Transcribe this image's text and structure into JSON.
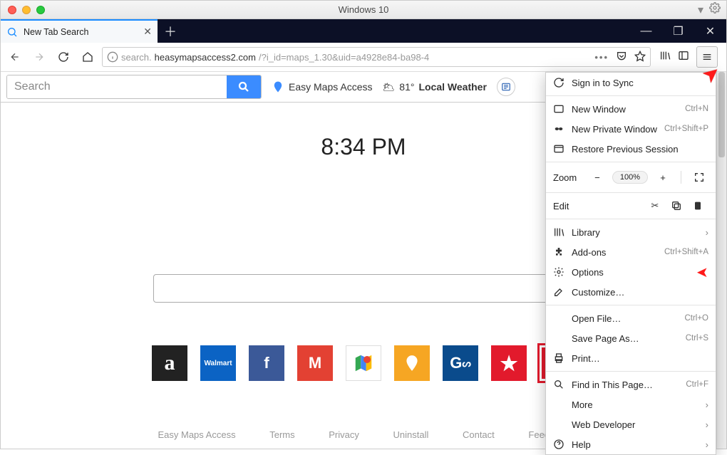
{
  "mac": {
    "title": "Windows 10"
  },
  "tab": {
    "title": "New Tab Search"
  },
  "nav": {
    "url_host": "heasymapsaccess2.com",
    "url_path": "/?i_id=maps_1.30&uid=a4928e84-ba98-4",
    "url_pre": "search."
  },
  "toolbar": {
    "search_placeholder": "Search",
    "ext_name": "Easy Maps Access",
    "weather_temp": "81°",
    "weather_label": "Local Weather"
  },
  "clock": "8:34 PM",
  "tiles": {
    "amazon": "a",
    "walmart": "Walmart",
    "fb": "f",
    "gmail": "M",
    "gmaps": "",
    "ymaps": "",
    "gas": "G",
    "macys": "★",
    "target": ""
  },
  "footer": {
    "a": "Easy Maps Access",
    "b": "Terms",
    "c": "Privacy",
    "d": "Uninstall",
    "e": "Contact",
    "f": "Feedback"
  },
  "menu": {
    "signin": "Sign in to Sync",
    "new_window": "New Window",
    "new_window_kb": "Ctrl+N",
    "priv_window": "New Private Window",
    "priv_window_kb": "Ctrl+Shift+P",
    "restore": "Restore Previous Session",
    "zoom_label": "Zoom",
    "zoom_pct": "100%",
    "edit_label": "Edit",
    "library": "Library",
    "addons": "Add-ons",
    "addons_kb": "Ctrl+Shift+A",
    "options": "Options",
    "customize": "Customize…",
    "open_file": "Open File…",
    "open_file_kb": "Ctrl+O",
    "save_as": "Save Page As…",
    "save_as_kb": "Ctrl+S",
    "print": "Print…",
    "find": "Find in This Page…",
    "find_kb": "Ctrl+F",
    "more": "More",
    "webdev": "Web Developer",
    "help": "Help"
  }
}
